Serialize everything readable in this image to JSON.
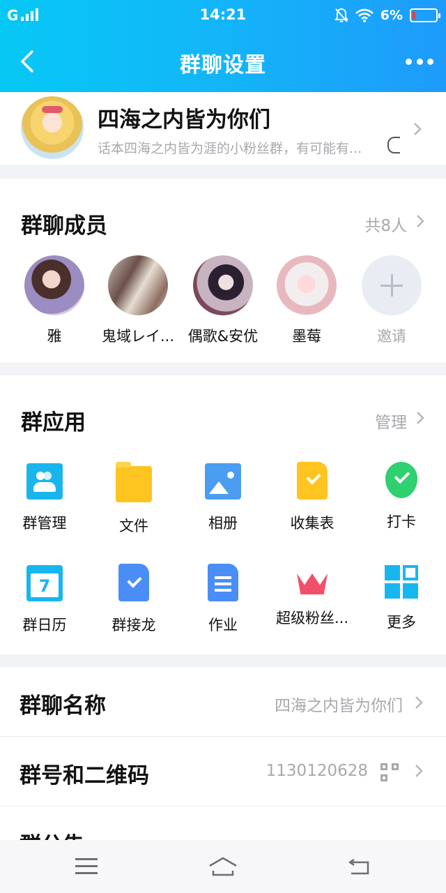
{
  "status_bar": {
    "carrier": "G",
    "time": "14:21",
    "battery": "6%",
    "battery_level": 0.06
  },
  "nav": {
    "title": "群聊设置"
  },
  "group": {
    "name": "四海之内皆为你们",
    "description": "话本四海之内皆为涯的小粉丝群，有可能有..."
  },
  "members": {
    "title": "群聊成员",
    "count": "共8人",
    "items": [
      {
        "name": "雅"
      },
      {
        "name": "鬼域レイ..."
      },
      {
        "name": "偶歌&安优"
      },
      {
        "name": "墨莓"
      }
    ],
    "invite_label": "邀请"
  },
  "apps": {
    "title": "群应用",
    "manage": "管理",
    "items": [
      {
        "label": "群管理",
        "icon": "group-manage-icon"
      },
      {
        "label": "文件",
        "icon": "folder-icon"
      },
      {
        "label": "相册",
        "icon": "photo-album-icon"
      },
      {
        "label": "收集表",
        "icon": "collect-form-icon"
      },
      {
        "label": "打卡",
        "icon": "check-in-icon"
      },
      {
        "label": "群日历",
        "icon": "calendar-icon"
      },
      {
        "label": "群接龙",
        "icon": "relay-icon"
      },
      {
        "label": "作业",
        "icon": "homework-icon"
      },
      {
        "label": "超级粉丝...",
        "icon": "crown-icon"
      },
      {
        "label": "更多",
        "icon": "more-grid-icon"
      }
    ]
  },
  "rows": {
    "name": {
      "label": "群聊名称",
      "value": "四海之内皆为你们"
    },
    "number": {
      "label": "群号和二维码",
      "value": "1130120628"
    },
    "notice": {
      "label": "群公告"
    }
  },
  "colors": {
    "header_start": "#06c8f5",
    "header_end": "#1e9bfb",
    "secondary_text": "#a8a8ae",
    "battery_low": "#ff3b30"
  }
}
